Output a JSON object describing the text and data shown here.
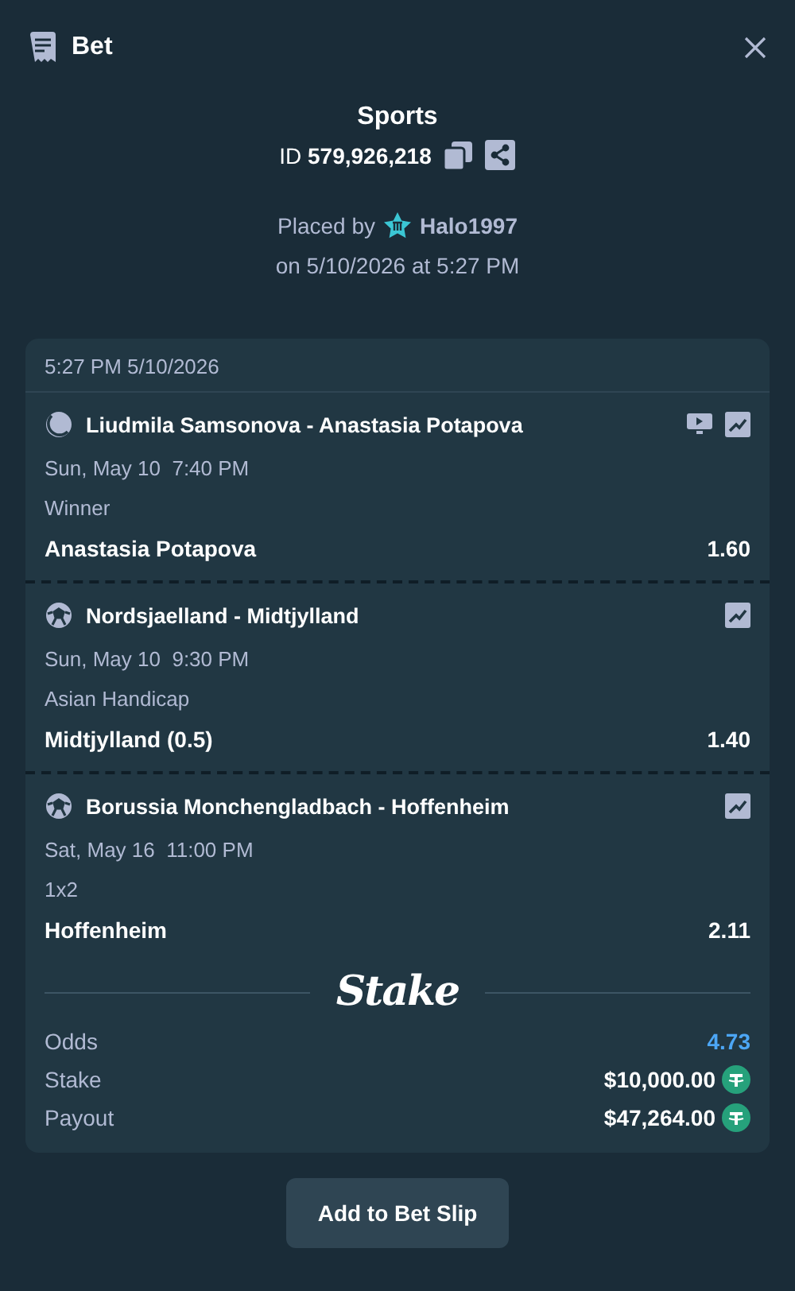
{
  "header": {
    "title": "Bet"
  },
  "summary": {
    "title": "Sports",
    "id_label": "ID",
    "id_value": "579,926,218",
    "placed_by_label": "Placed by",
    "user": "Halo1997",
    "placed_on": "on 5/10/2026 at 5:27 PM"
  },
  "card": {
    "timestamp": "5:27 PM 5/10/2026",
    "legs": [
      {
        "kind": "tennis",
        "event": "Liudmila Samsonova - Anastasia Potapova",
        "live_stream": true,
        "date": "Sun, May 10  7:40 PM",
        "market": "Winner",
        "selection": "Anastasia Potapova",
        "odds": "1.60"
      },
      {
        "kind": "soccer",
        "event": "Nordsjaelland - Midtjylland",
        "live_stream": false,
        "date": "Sun, May 10  9:30 PM",
        "market": "Asian Handicap",
        "selection": "Midtjylland (0.5)",
        "odds": "1.40"
      },
      {
        "kind": "soccer",
        "event": "Borussia Monchengladbach - Hoffenheim",
        "live_stream": false,
        "date": "Sat, May 16  11:00 PM",
        "market": "1x2",
        "selection": "Hoffenheim",
        "odds": "2.11"
      }
    ],
    "brand": "Stake",
    "totals": [
      {
        "kind": "odds",
        "label": "Odds",
        "value": "4.73"
      },
      {
        "kind": "amount",
        "label": "Stake",
        "value": "$10,000.00"
      },
      {
        "kind": "amount",
        "label": "Payout",
        "value": "$47,264.00"
      }
    ]
  },
  "button": "Add to Bet Slip"
}
